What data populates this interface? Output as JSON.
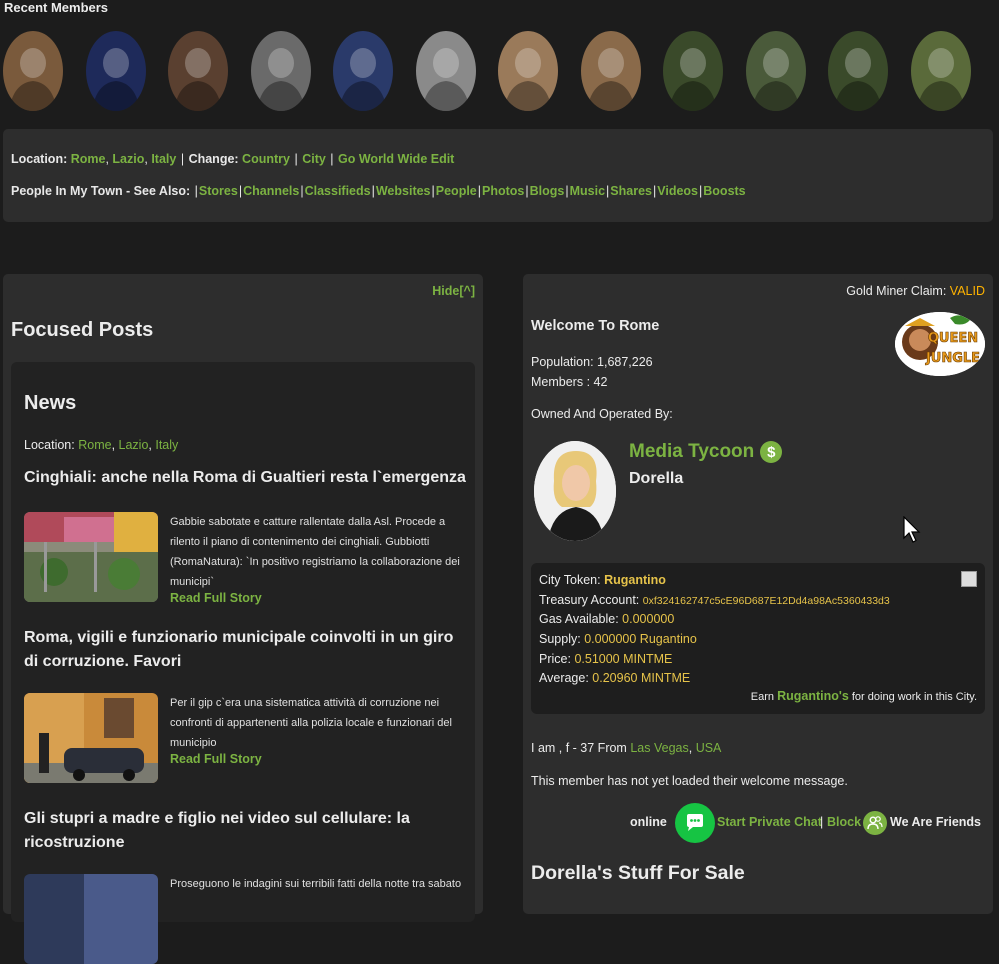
{
  "recent_members": {
    "title": "Recent Members",
    "avatars": [
      {
        "name": "member-avatar-1",
        "color": "#7a5a3c"
      },
      {
        "name": "member-avatar-2",
        "color": "#1e2a5a"
      },
      {
        "name": "member-avatar-3",
        "color": "#5a4030"
      },
      {
        "name": "member-avatar-4",
        "color": "#6a6a6a"
      },
      {
        "name": "member-avatar-5",
        "color": "#2a3a6a"
      },
      {
        "name": "member-avatar-6",
        "color": "#8a8a8a"
      },
      {
        "name": "member-avatar-7",
        "color": "#9a7a5a"
      },
      {
        "name": "member-avatar-8",
        "color": "#8a6a4a"
      },
      {
        "name": "member-avatar-9",
        "color": "#3a4a2a"
      },
      {
        "name": "member-avatar-10",
        "color": "#4a5a3a"
      },
      {
        "name": "member-avatar-11",
        "color": "#3a4a2a"
      },
      {
        "name": "member-avatar-12",
        "color": "#5a6a3a"
      }
    ]
  },
  "location_bar": {
    "location_label": "Location:",
    "city": "Rome",
    "region": "Lazio",
    "country": "Italy",
    "change_label": "Change:",
    "change_country": "Country",
    "change_city": "City",
    "go_world_wide": "Go World Wide Edit",
    "people_label": "People In My Town - See Also:",
    "see_also": [
      "Stores",
      "Channels",
      "Classifieds",
      "Websites",
      "People",
      "Photos",
      "Blogs",
      "Music",
      "Shares",
      "Videos",
      "Boosts"
    ]
  },
  "left": {
    "hide_label": "Hide[^]",
    "focused_title": "Focused Posts",
    "news_title": "News",
    "news_location_label": "Location:",
    "news_city": "Rome",
    "news_region": "Lazio",
    "news_country": "Italy",
    "read_more": "Read Full Story",
    "stories": [
      {
        "title": "Cinghiali: anche nella Roma di Gualtieri resta l`emergenza",
        "text": "Gabbie sabotate e catture rallentate dalla Asl. Procede a rilento il piano di contenimento dei cinghiali. Gubbiotti (RomaNatura): `In positivo registriamo la collaborazione dei municipi`"
      },
      {
        "title": "Roma, vigili e funzionario municipale coinvolti in un giro di corruzione. Favori",
        "text": "Per il gip c`era una sistematica attività di corruzione nei confronti di appartenenti alla polizia locale e funzionari del municipio"
      },
      {
        "title": "Gli stupri a madre e figlio nei video sul cellulare: la ricostruzione",
        "text": "Proseguono le indagini sui terribili fatti della notte tra sabato"
      }
    ]
  },
  "right": {
    "gold_label": "Gold Miner Claim:",
    "gold_status": "VALID",
    "welcome": "Welcome To Rome",
    "population": "Population: 1,687,226",
    "members": "Members : 42",
    "owned_by": "Owned And Operated By:",
    "owner_title": "Media Tycoon",
    "owner_name": "Dorella",
    "logo_text_1": "QUEEN",
    "logo_text_2": "JUNGLE",
    "token": {
      "city_token_label": "City Token:",
      "city_token": "Rugantino",
      "treasury_label": "Treasury Account:",
      "treasury": "0xf324162747c5cE96D687E12Dd4a98Ac5360433d3",
      "gas_label": "Gas Available:",
      "gas": "0.000000",
      "supply_label": "Supply:",
      "supply": "0.000000 Rugantino",
      "price_label": "Price:",
      "price": "0.51000 MINTME",
      "average_label": "Average:",
      "average": "0.20960 MINTME",
      "earn_prefix": "Earn",
      "earn_link": "Rugantino's",
      "earn_suffix": "for doing work in this City."
    },
    "iam_prefix": "I am , f - 37 From",
    "iam_city": "Las Vegas",
    "iam_country": "USA",
    "welcome_msg": "This member has not yet loaded their welcome message.",
    "online": "online",
    "chat_link": "Start Private Chat",
    "block_link": "Block",
    "friends": "We Are Friends",
    "stuff_title": "Dorella's Stuff For Sale"
  }
}
